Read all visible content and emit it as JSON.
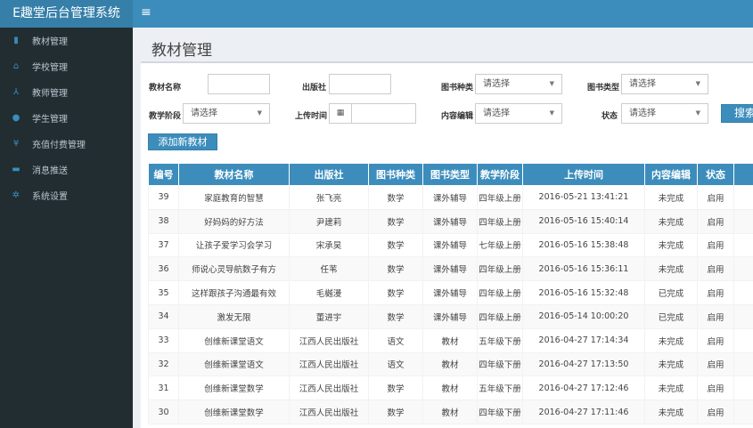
{
  "app_title": "E趣堂后台管理系统",
  "sidebar": {
    "items": [
      {
        "label": "教材管理",
        "icon": "book-icon"
      },
      {
        "label": "学校管理",
        "icon": "bank-icon"
      },
      {
        "label": "教师管理",
        "icon": "teacher-icon"
      },
      {
        "label": "学生管理",
        "icon": "user-icon"
      },
      {
        "label": "充值付费管理",
        "icon": "yen-icon"
      },
      {
        "label": "消息推送",
        "icon": "message-icon"
      },
      {
        "label": "系统设置",
        "icon": "gear-icon"
      }
    ]
  },
  "page_title": "教材管理",
  "filters": {
    "name_label": "教材名称",
    "name_value": "",
    "publisher_label": "出版社",
    "publisher_value": "",
    "category_label": "图书种类",
    "category_value": "请选择",
    "type_label": "图书类型",
    "type_value": "请选择",
    "stage_label": "教学阶段",
    "stage_value": "请选择",
    "upload_label": "上传时间",
    "upload_value": "",
    "edit_label": "内容编辑",
    "edit_value": "请选择",
    "status_label": "状态",
    "status_value": "请选择",
    "search_button": "搜索"
  },
  "add_button": "添加新教材",
  "table": {
    "headers": [
      "编号",
      "教材名称",
      "出版社",
      "图书种类",
      "图书类型",
      "教学阶段",
      "上传时间",
      "内容编辑",
      "状态",
      ""
    ],
    "rows": [
      [
        "39",
        "家庭教育的智慧",
        "张飞亮",
        "数学",
        "课外辅导",
        "四年级上册",
        "2016-05-21 13:41:21",
        "未完成",
        "启用"
      ],
      [
        "38",
        "好妈妈的好方法",
        "尹建莉",
        "数学",
        "课外辅导",
        "四年级上册",
        "2016-05-16 15:40:14",
        "未完成",
        "启用"
      ],
      [
        "37",
        "让孩子爱学习会学习",
        "宋承昊",
        "数学",
        "课外辅导",
        "七年级上册",
        "2016-05-16 15:38:48",
        "未完成",
        "启用"
      ],
      [
        "36",
        "师说心灵导航数子有方",
        "任苇",
        "数学",
        "课外辅导",
        "四年级上册",
        "2016-05-16 15:36:11",
        "未完成",
        "启用"
      ],
      [
        "35",
        "这样跟孩子沟通最有效",
        "毛樾漫",
        "数学",
        "课外辅导",
        "四年级上册",
        "2016-05-16 15:32:48",
        "已完成",
        "启用"
      ],
      [
        "34",
        "激发无限",
        "董进宇",
        "数学",
        "课外辅导",
        "四年级上册",
        "2016-05-14 10:00:20",
        "已完成",
        "启用"
      ],
      [
        "33",
        "创维新课堂语文",
        "江西人民出版社",
        "语文",
        "教材",
        "五年级下册",
        "2016-04-27 17:14:34",
        "未完成",
        "启用"
      ],
      [
        "32",
        "创维新课堂语文",
        "江西人民出版社",
        "语文",
        "教材",
        "四年级下册",
        "2016-04-27 17:13:50",
        "未完成",
        "启用"
      ],
      [
        "31",
        "创维新课堂数学",
        "江西人民出版社",
        "数学",
        "教材",
        "五年级下册",
        "2016-04-27 17:12:46",
        "未完成",
        "启用"
      ],
      [
        "30",
        "创维新课堂数学",
        "江西人民出版社",
        "数学",
        "教材",
        "四年级下册",
        "2016-04-27 17:11:46",
        "未完成",
        "启用"
      ]
    ]
  }
}
